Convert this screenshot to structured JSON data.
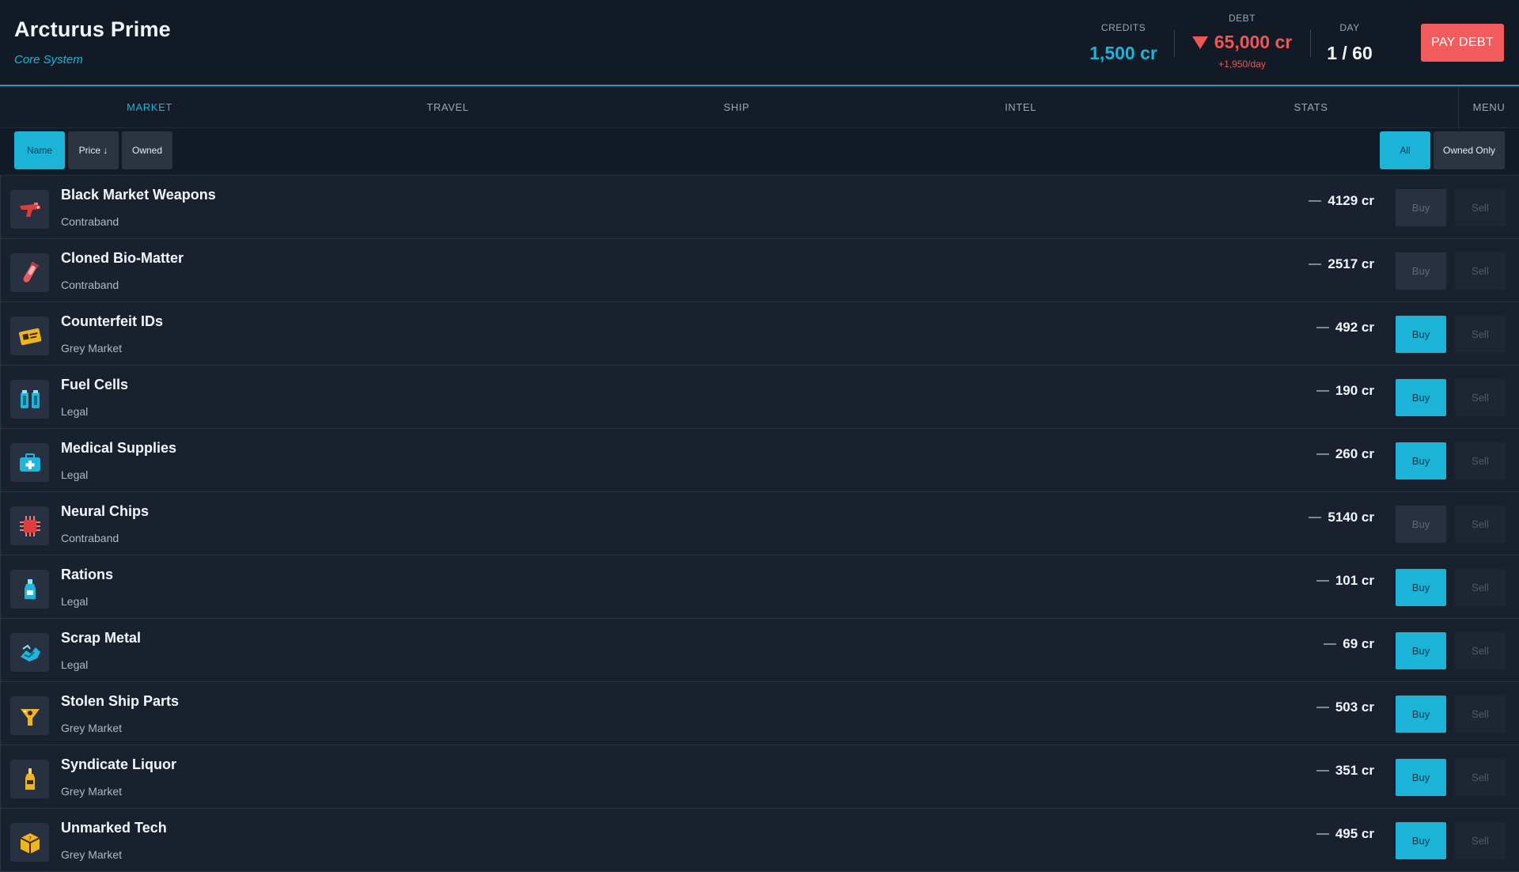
{
  "header": {
    "location_name": "Arcturus Prime",
    "system_name": "Core System",
    "credits_label": "CREDITS",
    "credits_value": "1,500 cr",
    "debt_label": "DEBT",
    "debt_value": "65,000 cr",
    "debt_rate": "+1,950/day",
    "day_label": "DAY",
    "day_value": "1 / 60",
    "pay_debt_label": "PAY DEBT"
  },
  "nav": {
    "tabs": [
      "MARKET",
      "TRAVEL",
      "SHIP",
      "INTEL",
      "STATS"
    ],
    "active_tab": "MARKET",
    "menu_label": "MENU"
  },
  "toolbar": {
    "sort_buttons": [
      "Name",
      "Price ↓",
      "Owned"
    ],
    "active_sort": "Name",
    "filter_buttons": [
      "All",
      "Owned Only"
    ],
    "active_filter": "All"
  },
  "market": {
    "buy_label": "Buy",
    "sell_label": "Sell",
    "items": [
      {
        "name": "Black Market Weapons",
        "category": "Contraband",
        "price": "4129 cr",
        "icon": "blaster-icon",
        "can_buy": false
      },
      {
        "name": "Cloned Bio-Matter",
        "category": "Contraband",
        "price": "2517 cr",
        "icon": "vial-icon",
        "can_buy": false
      },
      {
        "name": "Counterfeit IDs",
        "category": "Grey Market",
        "price": "492 cr",
        "icon": "id-card-icon",
        "can_buy": true
      },
      {
        "name": "Fuel Cells",
        "category": "Legal",
        "price": "190 cr",
        "icon": "fuel-cell-icon",
        "can_buy": true
      },
      {
        "name": "Medical Supplies",
        "category": "Legal",
        "price": "260 cr",
        "icon": "medkit-icon",
        "can_buy": true
      },
      {
        "name": "Neural Chips",
        "category": "Contraband",
        "price": "5140 cr",
        "icon": "chip-icon",
        "can_buy": false
      },
      {
        "name": "Rations",
        "category": "Legal",
        "price": "101 cr",
        "icon": "bottle-icon",
        "can_buy": true
      },
      {
        "name": "Scrap Metal",
        "category": "Legal",
        "price": "69 cr",
        "icon": "scrap-icon",
        "can_buy": true
      },
      {
        "name": "Stolen Ship Parts",
        "category": "Grey Market",
        "price": "503 cr",
        "icon": "ship-part-icon",
        "can_buy": true
      },
      {
        "name": "Syndicate Liquor",
        "category": "Grey Market",
        "price": "351 cr",
        "icon": "liquor-icon",
        "can_buy": true
      },
      {
        "name": "Unmarked Tech",
        "category": "Grey Market",
        "price": "495 cr",
        "icon": "crate-icon",
        "can_buy": true
      }
    ]
  },
  "colors": {
    "accent": "#18b6da",
    "danger": "#ef5656",
    "background": "#151e2c"
  }
}
